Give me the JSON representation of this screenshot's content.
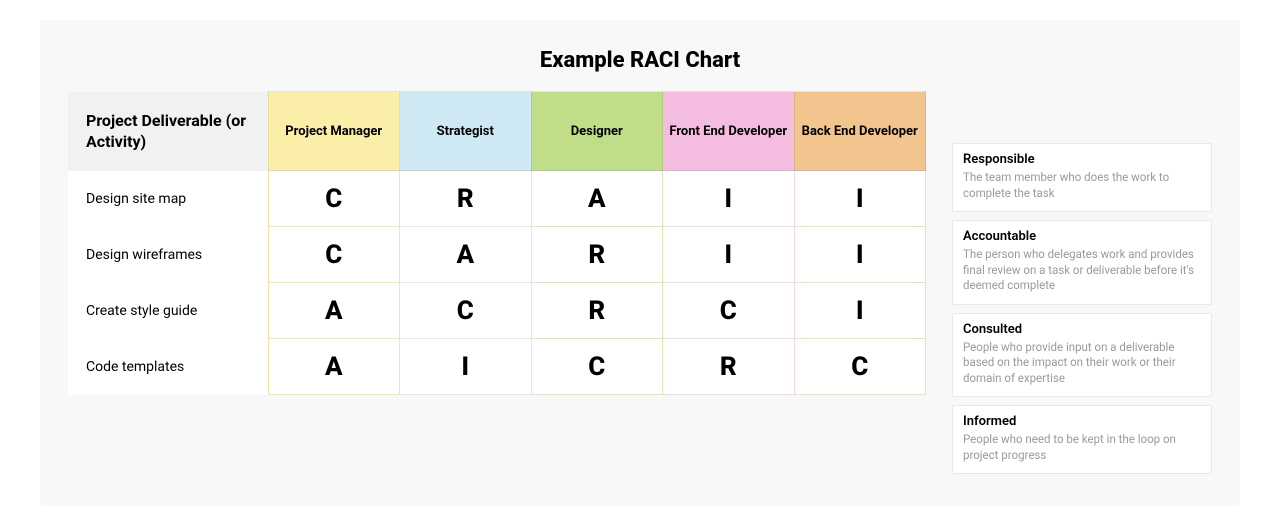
{
  "title": "Example RACI Chart",
  "corner_header": "Project Deliverable (or Activity)",
  "roles": [
    "Project Manager",
    "Strategist",
    "Designer",
    "Front End Developer",
    "Back End Developer"
  ],
  "tasks": [
    "Design site map",
    "Design wireframes",
    "Create style guide",
    "Code templates"
  ],
  "legend": [
    {
      "term": "Responsible",
      "def": "The team member who does the work to complete the task"
    },
    {
      "term": "Accountable",
      "def": "The person who delegates work and provides final review on a task or deliverable before it's deemed complete"
    },
    {
      "term": "Consulted",
      "def": "People who provide input on a deliverable based on the impact on their work or their domain of expertise"
    },
    {
      "term": "Informed",
      "def": "People who need to be kept in the loop on project progress"
    }
  ],
  "chart_data": {
    "type": "table",
    "title": "Example RACI Chart",
    "columns": [
      "Project Manager",
      "Strategist",
      "Designer",
      "Front End Developer",
      "Back End Developer"
    ],
    "rows": [
      "Design site map",
      "Design wireframes",
      "Create style guide",
      "Code templates"
    ],
    "values": [
      [
        "C",
        "R",
        "A",
        "I",
        "I"
      ],
      [
        "C",
        "A",
        "R",
        "I",
        "I"
      ],
      [
        "A",
        "C",
        "R",
        "C",
        "I"
      ],
      [
        "A",
        "I",
        "C",
        "R",
        "C"
      ]
    ],
    "codes": {
      "R": "Responsible",
      "A": "Accountable",
      "C": "Consulted",
      "I": "Informed"
    }
  }
}
